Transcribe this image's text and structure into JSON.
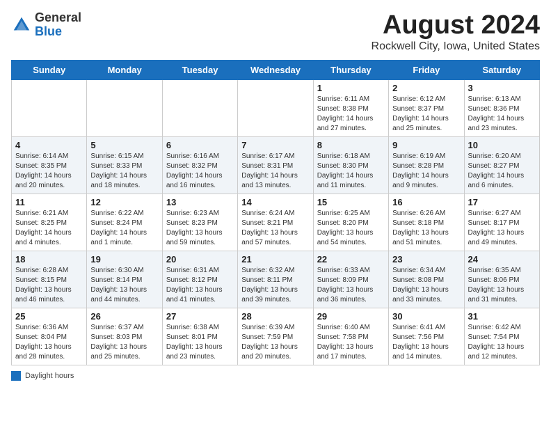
{
  "header": {
    "logo_general": "General",
    "logo_blue": "Blue",
    "title": "August 2024",
    "subtitle": "Rockwell City, Iowa, United States"
  },
  "weekdays": [
    "Sunday",
    "Monday",
    "Tuesday",
    "Wednesday",
    "Thursday",
    "Friday",
    "Saturday"
  ],
  "weeks": [
    [
      {
        "day": "",
        "info": ""
      },
      {
        "day": "",
        "info": ""
      },
      {
        "day": "",
        "info": ""
      },
      {
        "day": "",
        "info": ""
      },
      {
        "day": "1",
        "info": "Sunrise: 6:11 AM\nSunset: 8:38 PM\nDaylight: 14 hours and 27 minutes."
      },
      {
        "day": "2",
        "info": "Sunrise: 6:12 AM\nSunset: 8:37 PM\nDaylight: 14 hours and 25 minutes."
      },
      {
        "day": "3",
        "info": "Sunrise: 6:13 AM\nSunset: 8:36 PM\nDaylight: 14 hours and 23 minutes."
      }
    ],
    [
      {
        "day": "4",
        "info": "Sunrise: 6:14 AM\nSunset: 8:35 PM\nDaylight: 14 hours and 20 minutes."
      },
      {
        "day": "5",
        "info": "Sunrise: 6:15 AM\nSunset: 8:33 PM\nDaylight: 14 hours and 18 minutes."
      },
      {
        "day": "6",
        "info": "Sunrise: 6:16 AM\nSunset: 8:32 PM\nDaylight: 14 hours and 16 minutes."
      },
      {
        "day": "7",
        "info": "Sunrise: 6:17 AM\nSunset: 8:31 PM\nDaylight: 14 hours and 13 minutes."
      },
      {
        "day": "8",
        "info": "Sunrise: 6:18 AM\nSunset: 8:30 PM\nDaylight: 14 hours and 11 minutes."
      },
      {
        "day": "9",
        "info": "Sunrise: 6:19 AM\nSunset: 8:28 PM\nDaylight: 14 hours and 9 minutes."
      },
      {
        "day": "10",
        "info": "Sunrise: 6:20 AM\nSunset: 8:27 PM\nDaylight: 14 hours and 6 minutes."
      }
    ],
    [
      {
        "day": "11",
        "info": "Sunrise: 6:21 AM\nSunset: 8:25 PM\nDaylight: 14 hours and 4 minutes."
      },
      {
        "day": "12",
        "info": "Sunrise: 6:22 AM\nSunset: 8:24 PM\nDaylight: 14 hours and 1 minute."
      },
      {
        "day": "13",
        "info": "Sunrise: 6:23 AM\nSunset: 8:23 PM\nDaylight: 13 hours and 59 minutes."
      },
      {
        "day": "14",
        "info": "Sunrise: 6:24 AM\nSunset: 8:21 PM\nDaylight: 13 hours and 57 minutes."
      },
      {
        "day": "15",
        "info": "Sunrise: 6:25 AM\nSunset: 8:20 PM\nDaylight: 13 hours and 54 minutes."
      },
      {
        "day": "16",
        "info": "Sunrise: 6:26 AM\nSunset: 8:18 PM\nDaylight: 13 hours and 51 minutes."
      },
      {
        "day": "17",
        "info": "Sunrise: 6:27 AM\nSunset: 8:17 PM\nDaylight: 13 hours and 49 minutes."
      }
    ],
    [
      {
        "day": "18",
        "info": "Sunrise: 6:28 AM\nSunset: 8:15 PM\nDaylight: 13 hours and 46 minutes."
      },
      {
        "day": "19",
        "info": "Sunrise: 6:30 AM\nSunset: 8:14 PM\nDaylight: 13 hours and 44 minutes."
      },
      {
        "day": "20",
        "info": "Sunrise: 6:31 AM\nSunset: 8:12 PM\nDaylight: 13 hours and 41 minutes."
      },
      {
        "day": "21",
        "info": "Sunrise: 6:32 AM\nSunset: 8:11 PM\nDaylight: 13 hours and 39 minutes."
      },
      {
        "day": "22",
        "info": "Sunrise: 6:33 AM\nSunset: 8:09 PM\nDaylight: 13 hours and 36 minutes."
      },
      {
        "day": "23",
        "info": "Sunrise: 6:34 AM\nSunset: 8:08 PM\nDaylight: 13 hours and 33 minutes."
      },
      {
        "day": "24",
        "info": "Sunrise: 6:35 AM\nSunset: 8:06 PM\nDaylight: 13 hours and 31 minutes."
      }
    ],
    [
      {
        "day": "25",
        "info": "Sunrise: 6:36 AM\nSunset: 8:04 PM\nDaylight: 13 hours and 28 minutes."
      },
      {
        "day": "26",
        "info": "Sunrise: 6:37 AM\nSunset: 8:03 PM\nDaylight: 13 hours and 25 minutes."
      },
      {
        "day": "27",
        "info": "Sunrise: 6:38 AM\nSunset: 8:01 PM\nDaylight: 13 hours and 23 minutes."
      },
      {
        "day": "28",
        "info": "Sunrise: 6:39 AM\nSunset: 7:59 PM\nDaylight: 13 hours and 20 minutes."
      },
      {
        "day": "29",
        "info": "Sunrise: 6:40 AM\nSunset: 7:58 PM\nDaylight: 13 hours and 17 minutes."
      },
      {
        "day": "30",
        "info": "Sunrise: 6:41 AM\nSunset: 7:56 PM\nDaylight: 13 hours and 14 minutes."
      },
      {
        "day": "31",
        "info": "Sunrise: 6:42 AM\nSunset: 7:54 PM\nDaylight: 13 hours and 12 minutes."
      }
    ]
  ],
  "footer": {
    "daylight_label": "Daylight hours"
  }
}
